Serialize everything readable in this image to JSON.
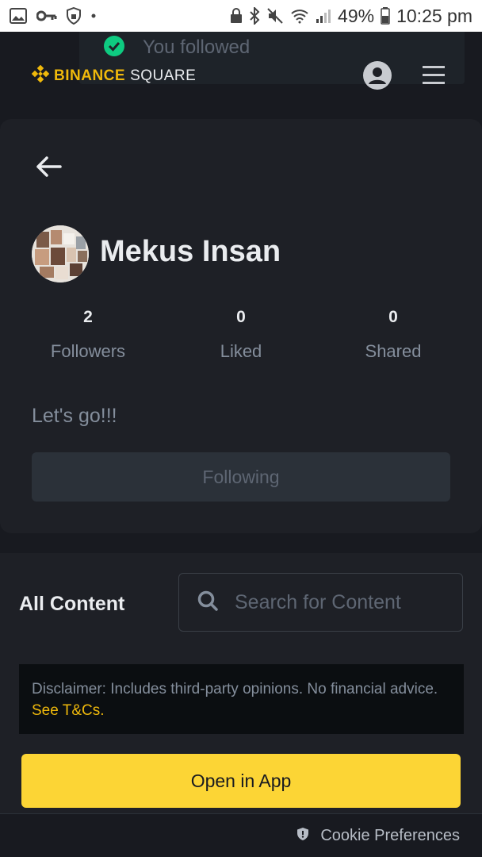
{
  "status_bar": {
    "battery_percent": "49%",
    "time": "10:25 pm",
    "left_icons": [
      "image-icon",
      "key-icon",
      "shield-icon",
      "dot-icon"
    ],
    "right_icons": [
      "lock-icon",
      "bluetooth-icon",
      "mute-icon",
      "wifi-icon",
      "signal-icon",
      "battery-icon"
    ]
  },
  "toast": {
    "text": "You followed",
    "icon": "check-circle-icon",
    "color": "#0ecb81"
  },
  "header": {
    "logo_brand": "BINANCE",
    "logo_product": "SQUARE",
    "brand_color": "#f0b90b"
  },
  "profile": {
    "name": "Mekus Insan",
    "stats": [
      {
        "value": "2",
        "label": "Followers"
      },
      {
        "value": "0",
        "label": "Liked"
      },
      {
        "value": "0",
        "label": "Shared"
      }
    ],
    "bio": "Let's go!!!",
    "follow_button_label": "Following"
  },
  "content": {
    "section_title": "All Content",
    "search_placeholder": "Search for Content"
  },
  "disclaimer": {
    "text": "Disclaimer: Includes third-party opinions. No financial advice.",
    "link": "See T&Cs."
  },
  "open_app_label": "Open in App",
  "cookie_label": "Cookie Preferences"
}
